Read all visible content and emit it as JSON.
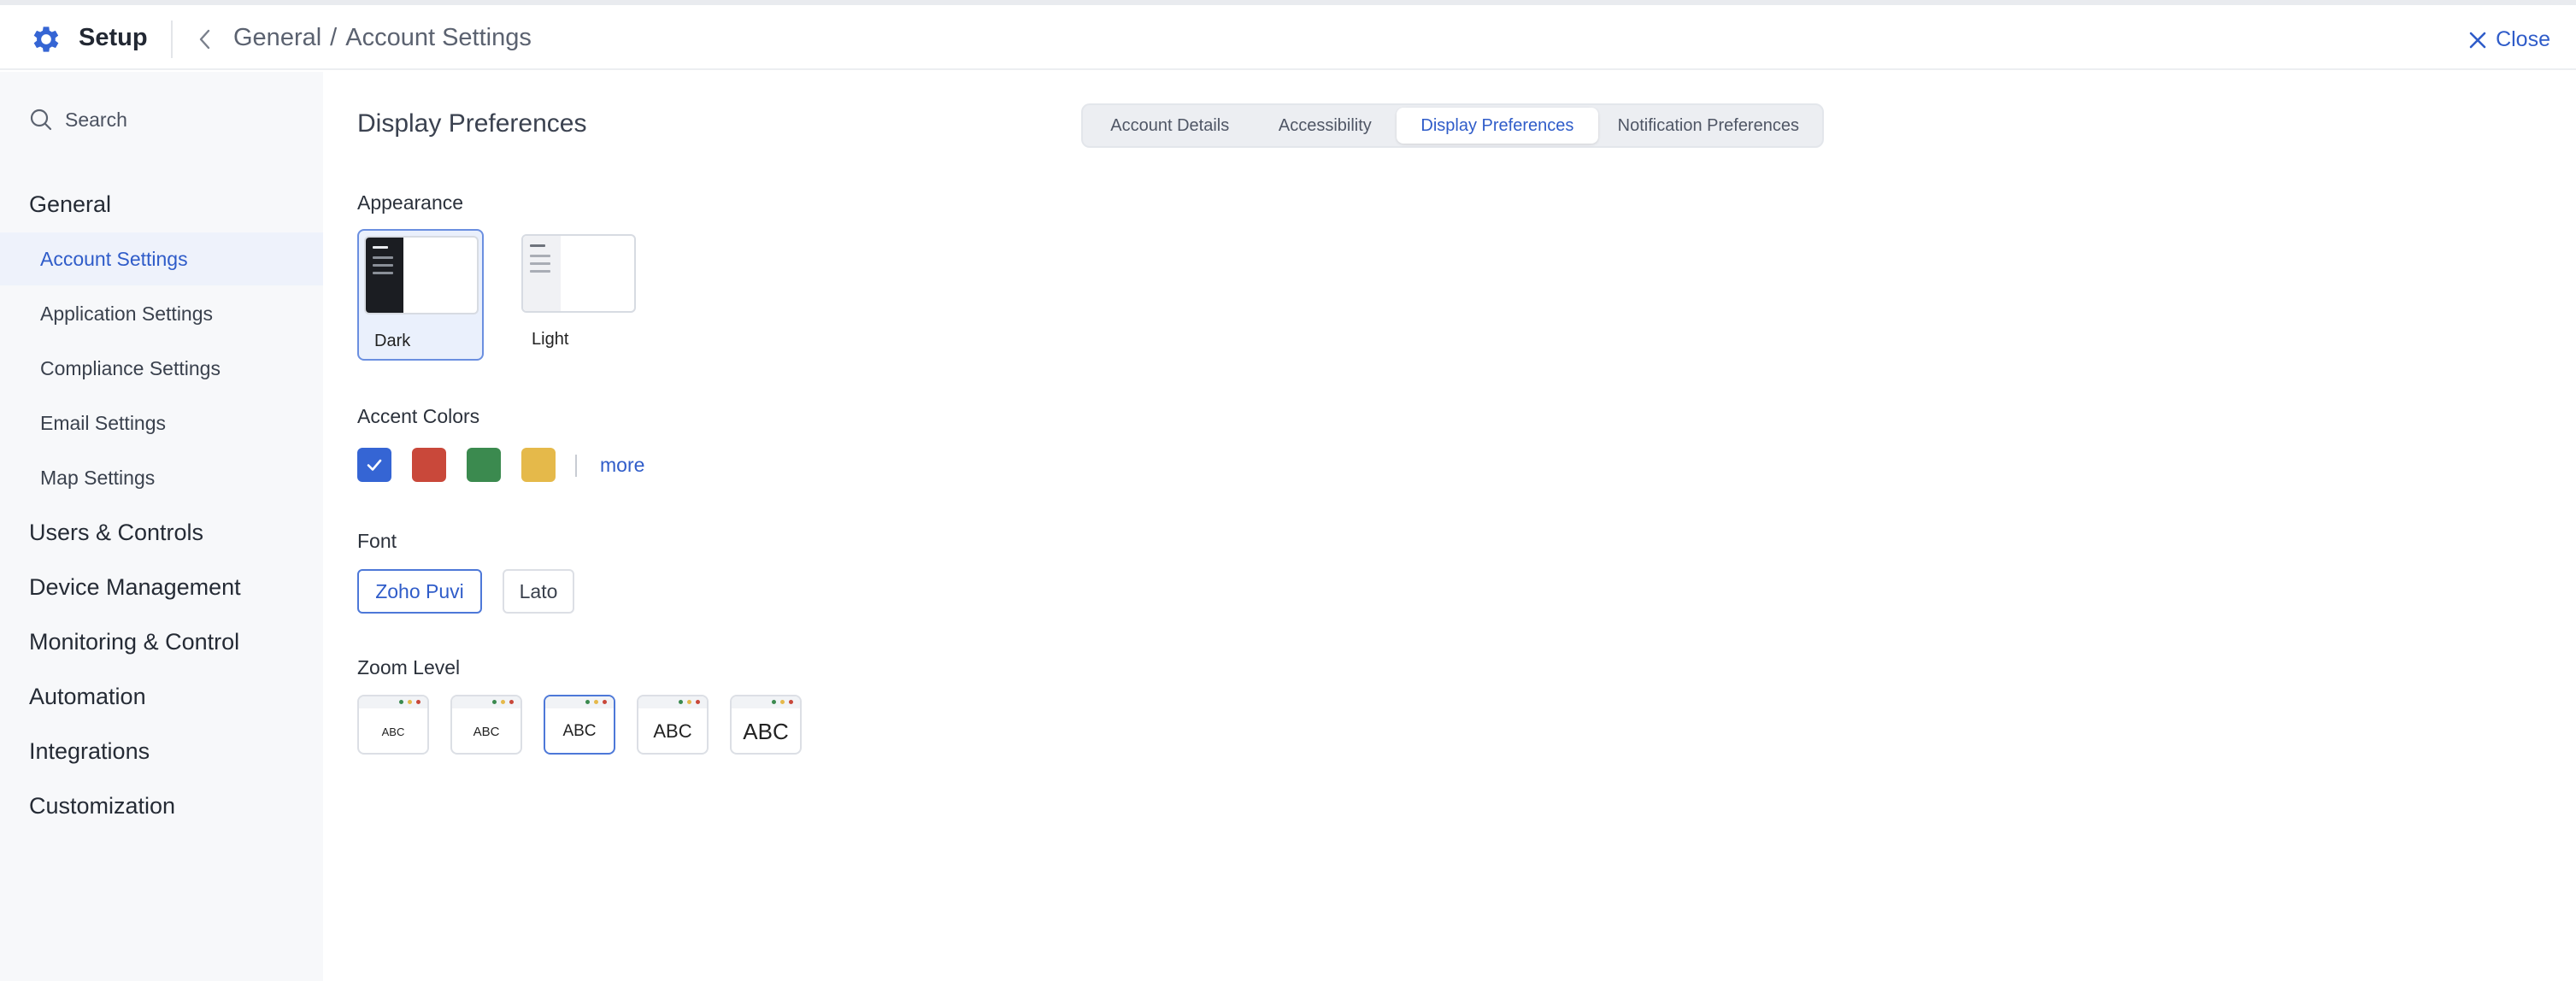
{
  "header": {
    "app_title": "Setup",
    "breadcrumb": {
      "parent": "General",
      "separator": "/",
      "current": "Account Settings"
    },
    "close_label": "Close",
    "accent_color": "#2f5cc9"
  },
  "sidebar": {
    "search_placeholder": "Search",
    "groups": [
      {
        "label": "General",
        "items": [
          {
            "label": "Account Settings",
            "active": true
          },
          {
            "label": "Application Settings"
          },
          {
            "label": "Compliance Settings"
          },
          {
            "label": "Email Settings"
          },
          {
            "label": "Map Settings"
          }
        ]
      },
      {
        "label": "Users & Controls"
      },
      {
        "label": "Device Management"
      },
      {
        "label": "Monitoring & Control"
      },
      {
        "label": "Automation"
      },
      {
        "label": "Integrations"
      },
      {
        "label": "Customization"
      }
    ]
  },
  "main": {
    "page_title": "Display Preferences",
    "tabs": [
      {
        "label": "Account Details"
      },
      {
        "label": "Accessibility"
      },
      {
        "label": "Display Preferences",
        "active": true
      },
      {
        "label": "Notification Preferences"
      }
    ],
    "appearance": {
      "label": "Appearance",
      "options": [
        {
          "label": "Dark",
          "selected": true,
          "icon": "dark-theme-thumbnail"
        },
        {
          "label": "Light",
          "selected": false,
          "icon": "light-theme-thumbnail"
        }
      ]
    },
    "accent_colors": {
      "label": "Accent Colors",
      "swatches": [
        {
          "color": "#3565d4",
          "selected": true
        },
        {
          "color": "#c9483a"
        },
        {
          "color": "#3b8a4f"
        },
        {
          "color": "#e5b94a"
        }
      ],
      "more_label": "more"
    },
    "font": {
      "label": "Font",
      "options": [
        {
          "label": "Zoho Puvi",
          "selected": true
        },
        {
          "label": "Lato"
        }
      ]
    },
    "zoom_level": {
      "label": "Zoom Level",
      "options": [
        {
          "text": "ABC"
        },
        {
          "text": "ABC"
        },
        {
          "text": "ABC",
          "selected": true
        },
        {
          "text": "ABC"
        },
        {
          "text": "ABC"
        }
      ]
    }
  }
}
